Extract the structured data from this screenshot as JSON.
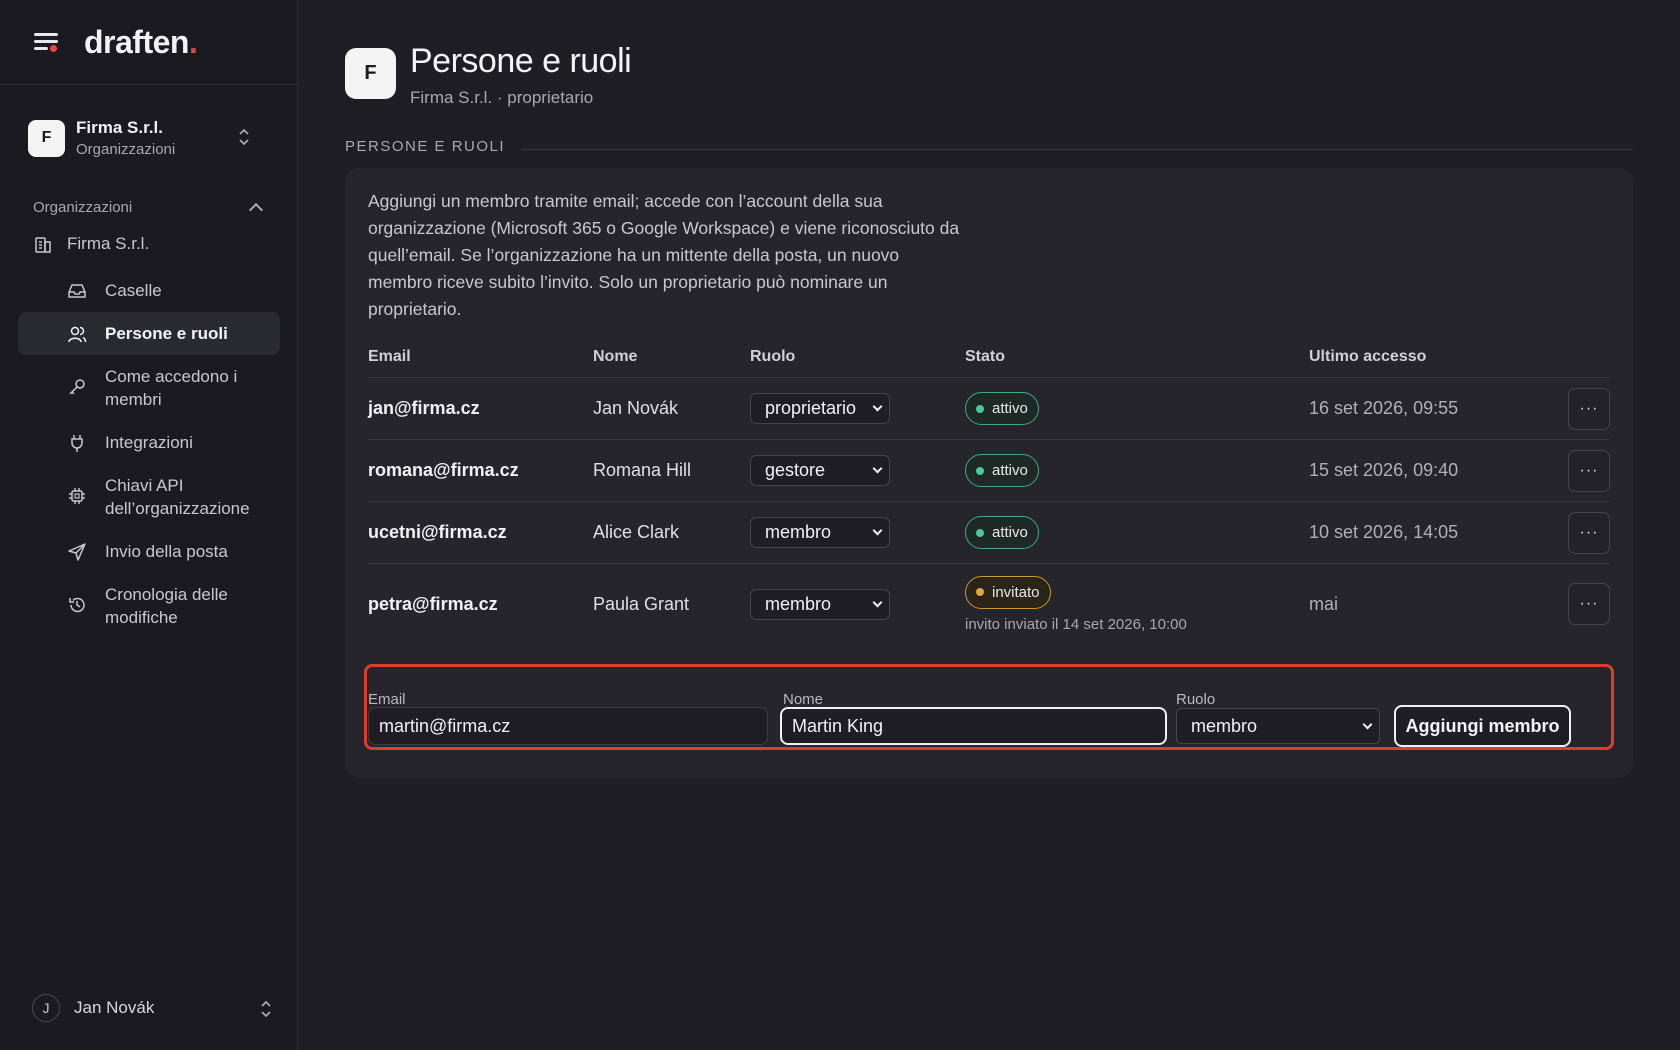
{
  "brand": {
    "logo_text": "draften",
    "logo_dot": ".",
    "accent": "#e8483c"
  },
  "sidebar": {
    "org_switcher": {
      "initial": "F",
      "name": "Firma S.r.l.",
      "subtitle": "Organizzazioni"
    },
    "section_title": "Organizzazioni",
    "org_item": "Firma S.r.l.",
    "items": [
      {
        "label": "Caselle",
        "icon": "inbox-icon"
      },
      {
        "label": "Persone e ruoli",
        "icon": "users-icon",
        "active": true
      },
      {
        "label": "Come accedono i membri",
        "icon": "key-icon"
      },
      {
        "label": "Integrazioni",
        "icon": "plug-icon"
      },
      {
        "label": "Chiavi API dell’organizzazione",
        "icon": "chip-icon"
      },
      {
        "label": "Invio della posta",
        "icon": "send-icon"
      },
      {
        "label": "Cronologia delle modifiche",
        "icon": "history-icon"
      }
    ],
    "user": {
      "initial": "J",
      "name": "Jan Novák"
    }
  },
  "page": {
    "avatar_initial": "F",
    "title": "Persone e ruoli",
    "subtitle": "Firma S.r.l. · proprietario",
    "section_label": "PERSONE E RUOLI",
    "description": "Aggiungi un membro tramite email; accede con l’account della sua organizzazione (Microsoft 365 o Google Workspace) e viene riconosciuto da quell’email. Se l’organizzazione ha un mittente della posta, un nuovo membro riceve subito l’invito. Solo un proprietario può nominare un proprietario."
  },
  "table": {
    "headers": {
      "email": "Email",
      "nome": "Nome",
      "ruolo": "Ruolo",
      "stato": "Stato",
      "ultimo_accesso": "Ultimo accesso"
    },
    "rows": [
      {
        "email": "jan@firma.cz",
        "nome": "Jan Novák",
        "ruolo": "proprietario",
        "stato": "attivo",
        "ultimo_accesso": "16 set 2026, 09:55"
      },
      {
        "email": "romana@firma.cz",
        "nome": "Romana Hill",
        "ruolo": "gestore",
        "stato": "attivo",
        "ultimo_accesso": "15 set 2026, 09:40"
      },
      {
        "email": "ucetni@firma.cz",
        "nome": "Alice Clark",
        "ruolo": "membro",
        "stato": "attivo",
        "ultimo_accesso": "10 set 2026, 14:05"
      },
      {
        "email": "petra@firma.cz",
        "nome": "Paula Grant",
        "ruolo": "membro",
        "stato": "invitato",
        "note": "invito inviato il 14 set 2026, 10:00",
        "ultimo_accesso": "mai"
      }
    ],
    "more_label": "···"
  },
  "add_form": {
    "email_label": "Email",
    "email_value": "martin@firma.cz",
    "name_label": "Nome",
    "name_value": "Martin King",
    "role_label": "Ruolo",
    "role_value": "membro",
    "submit_label": "Aggiungi membro",
    "highlight_color": "#e23b2e"
  },
  "colors": {
    "status_ok": "#4cc79f",
    "status_invited": "#e2a63a"
  }
}
